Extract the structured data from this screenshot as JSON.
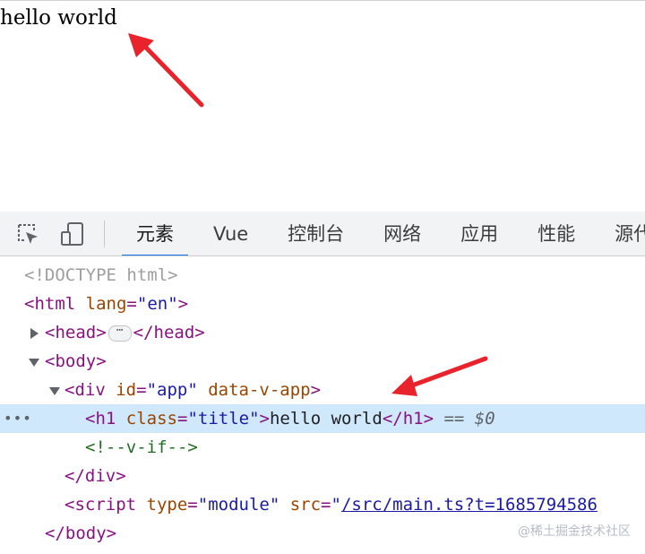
{
  "page": {
    "heading": "hello world"
  },
  "toolbar": {
    "icons": [
      "inspect-element-icon",
      "device-toolbar-icon"
    ],
    "tabs": [
      {
        "label": "元素",
        "active": true
      },
      {
        "label": "Vue",
        "active": false
      },
      {
        "label": "控制台",
        "active": false
      },
      {
        "label": "网络",
        "active": false
      },
      {
        "label": "应用",
        "active": false
      },
      {
        "label": "性能",
        "active": false
      },
      {
        "label": "源代",
        "active": false
      }
    ]
  },
  "dom": {
    "doctype": "<!DOCTYPE html>",
    "html": {
      "open": "<html",
      "attr": "lang",
      "val": "\"en\"",
      "close": ">"
    },
    "head": {
      "open": "<head>",
      "end": "</head>",
      "ellipsis": "⋯"
    },
    "body": {
      "open": "<body>",
      "end": "</body>"
    },
    "div": {
      "open": "<div",
      "attr1": "id",
      "val1": "\"app\"",
      "attr2": "data-v-app",
      "close": ">",
      "end": "</div>"
    },
    "h1": {
      "open": "<h1",
      "attr": "class",
      "val": "\"title\"",
      "close": ">",
      "text": "hello world",
      "end": "</h1>",
      "marker": "== $0",
      "dots": "•••"
    },
    "comment": "<!--v-if-->",
    "script": {
      "open": "<script",
      "attr1": "type",
      "val1": "\"module\"",
      "attr2": "src",
      "quote": "\"",
      "src": "/src/main.ts?t=1685794586"
    }
  },
  "watermark": "@稀土掘金技术社区",
  "colors": {
    "arrow": "#e8232b",
    "tag": "#881280",
    "attr": "#994500",
    "value": "#1a1aa6",
    "comment": "#236e25",
    "selected_row": "#cfe8fc",
    "active_tab": "#1a73e8"
  }
}
